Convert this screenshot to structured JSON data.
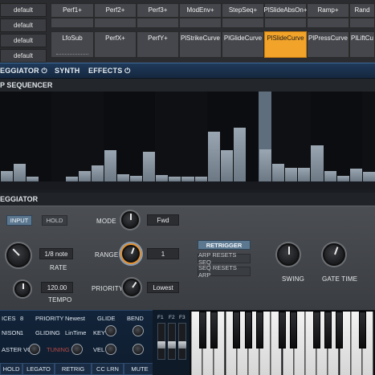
{
  "presets": [
    "default",
    "default",
    "default",
    "default"
  ],
  "mod_row1": [
    "Perf1+",
    "Perf2+",
    "Perf3+",
    "ModEnv+",
    "StepSeq+",
    "PlSlideAbsOn+",
    "Ramp+",
    "Rand"
  ],
  "mod_row2": [
    "LfoSub",
    "PerfX+",
    "PerfY+",
    "PlStrikeCurve",
    "PlGlideCurve",
    "PlSlideCurve",
    "PlPressCurve",
    "PlLiftCu"
  ],
  "mod_active": "PlSlideCurve",
  "tabs": {
    "arpeggiator": "EGGIATOR",
    "arp_power": "⏻",
    "synth": "SYNTH",
    "effects": "EFFECTS",
    "effects_power": "⏻"
  },
  "step_sequencer": {
    "title": "P SEQUENCER",
    "steps": [
      0.12,
      0.2,
      0.05,
      0.0,
      0.0,
      0.05,
      0.12,
      0.18,
      0.35,
      0.08,
      0.06,
      0.33,
      0.07,
      0.05,
      0.05,
      0.05,
      0.55,
      0.35,
      0.6,
      0.0,
      0.36,
      0.2,
      0.15,
      0.15,
      0.4,
      0.12,
      0.06,
      0.14,
      0.11
    ],
    "highlight_step": 20
  },
  "arpeggiator": {
    "title": "EGGIATOR",
    "input_label": "INPUT",
    "hold_label": "HOLD",
    "mode_label": "MODE",
    "mode_value": "Fwd",
    "rate_value": "1/8 note",
    "rate_label": "RATE",
    "range_label": "RANGE",
    "range_value": "1",
    "retrigger_label": "RETRIGGER",
    "arp_resets_seq": "ARP RESETS SEQ",
    "seq_resets_arp": "SEQ RESETS ARP",
    "tempo_value": "120.00",
    "tempo_label": "TEMPO",
    "priority_label": "PRIORITY",
    "priority_value": "Lowest",
    "swing_label": "SWING",
    "gate_time_label": "GATE TIME"
  },
  "synth_strip": {
    "voices_label": "ICES",
    "voices_value": "8",
    "priority_label": "PRIORITY",
    "priority_value": "Newest",
    "glide_label": "GLIDE",
    "bend_label": "BEND",
    "unison_label": "NISON",
    "unison_value": "1",
    "gliding_label": "GLIDING",
    "gliding_value": "LinTime",
    "key_label": "KEY",
    "master_vol_label": "ASTER VOL",
    "tuning_label": "TUNING",
    "vel_label": "VEL",
    "fader_labels": [
      "F1",
      "F2",
      "F3"
    ]
  },
  "bottom_buttons": [
    "HOLD",
    "LEGATO",
    "RETRIG",
    "CC LRN",
    "MUTE"
  ],
  "keyboard_octaves_visible": 2
}
